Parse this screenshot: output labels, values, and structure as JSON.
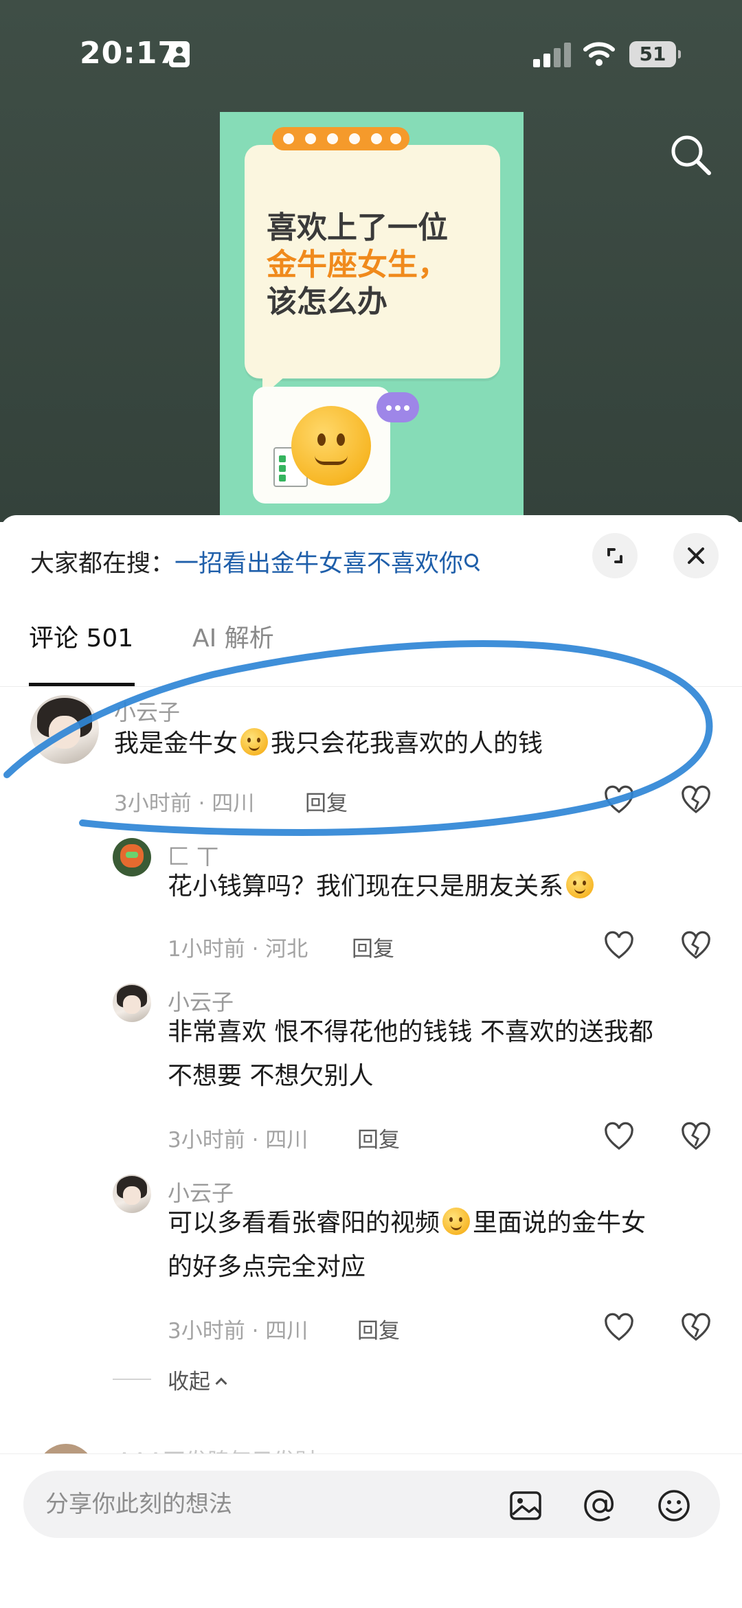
{
  "status_bar": {
    "time": "20:17",
    "battery": "51"
  },
  "cover": {
    "line1": "喜欢上了一位",
    "line2": "金牛座女生，",
    "line3": "该怎么办"
  },
  "suggest": {
    "prefix": "大家都在搜：",
    "query": "一招看出金牛女喜不喜欢你"
  },
  "tabs": [
    {
      "label": "评论 501"
    },
    {
      "label": "AI 解析"
    }
  ],
  "comments": [
    {
      "username": "小云子",
      "text_a": "我是金牛女",
      "emoji": "🙂",
      "text_b": "我只会花我喜欢的人的钱",
      "meta": "3小时前 · 四川",
      "reply_label": "回复"
    },
    {
      "username": "匚 丅",
      "text_a": "花小钱算吗？我们现在只是朋友关系",
      "emoji": "😚",
      "meta": "1小时前 · 河北",
      "reply_label": "回复"
    },
    {
      "username": "小云子",
      "line1": "非常喜欢 恨不得花他的钱钱 不喜欢的送我都",
      "line2": "不想要 不想欠别人",
      "meta": "3小时前 · 四川",
      "reply_label": "回复"
    },
    {
      "username": "小云子",
      "line1_a": "可以多看看张睿阳的视频",
      "emoji": "🤣",
      "line1_b": "里面说的金牛女",
      "line2": "的好多点完全对应",
      "meta": "3小时前 · 四川",
      "reply_label": "回复"
    }
  ],
  "collapse_label": "收起",
  "next_username": "AAA不发脾气只发财",
  "input": {
    "placeholder": "分享你此刻的想法"
  },
  "icons": [
    "id-card-icon",
    "signal-icon",
    "wifi-icon",
    "battery-icon",
    "search-icon",
    "expand-icon",
    "close-icon",
    "heart-icon",
    "broken-heart-icon",
    "image-icon",
    "at-icon",
    "emoji-icon"
  ]
}
